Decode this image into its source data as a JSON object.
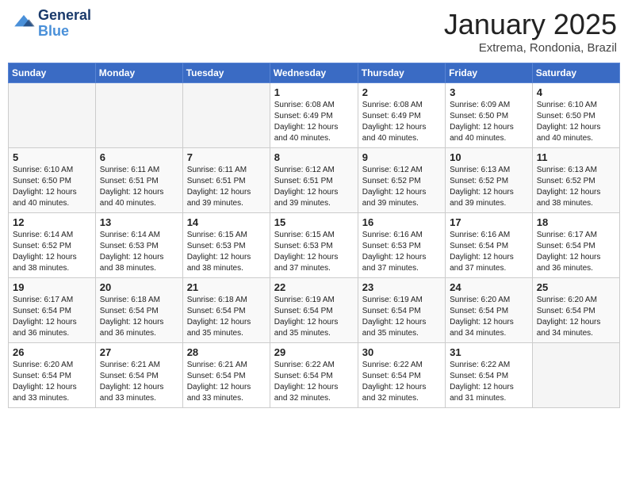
{
  "header": {
    "logo_line1": "General",
    "logo_line2": "Blue",
    "month": "January 2025",
    "location": "Extrema, Rondonia, Brazil"
  },
  "days_of_week": [
    "Sunday",
    "Monday",
    "Tuesday",
    "Wednesday",
    "Thursday",
    "Friday",
    "Saturday"
  ],
  "weeks": [
    [
      {
        "day": "",
        "info": ""
      },
      {
        "day": "",
        "info": ""
      },
      {
        "day": "",
        "info": ""
      },
      {
        "day": "1",
        "info": "Sunrise: 6:08 AM\nSunset: 6:49 PM\nDaylight: 12 hours\nand 40 minutes."
      },
      {
        "day": "2",
        "info": "Sunrise: 6:08 AM\nSunset: 6:49 PM\nDaylight: 12 hours\nand 40 minutes."
      },
      {
        "day": "3",
        "info": "Sunrise: 6:09 AM\nSunset: 6:50 PM\nDaylight: 12 hours\nand 40 minutes."
      },
      {
        "day": "4",
        "info": "Sunrise: 6:10 AM\nSunset: 6:50 PM\nDaylight: 12 hours\nand 40 minutes."
      }
    ],
    [
      {
        "day": "5",
        "info": "Sunrise: 6:10 AM\nSunset: 6:50 PM\nDaylight: 12 hours\nand 40 minutes."
      },
      {
        "day": "6",
        "info": "Sunrise: 6:11 AM\nSunset: 6:51 PM\nDaylight: 12 hours\nand 40 minutes."
      },
      {
        "day": "7",
        "info": "Sunrise: 6:11 AM\nSunset: 6:51 PM\nDaylight: 12 hours\nand 39 minutes."
      },
      {
        "day": "8",
        "info": "Sunrise: 6:12 AM\nSunset: 6:51 PM\nDaylight: 12 hours\nand 39 minutes."
      },
      {
        "day": "9",
        "info": "Sunrise: 6:12 AM\nSunset: 6:52 PM\nDaylight: 12 hours\nand 39 minutes."
      },
      {
        "day": "10",
        "info": "Sunrise: 6:13 AM\nSunset: 6:52 PM\nDaylight: 12 hours\nand 39 minutes."
      },
      {
        "day": "11",
        "info": "Sunrise: 6:13 AM\nSunset: 6:52 PM\nDaylight: 12 hours\nand 38 minutes."
      }
    ],
    [
      {
        "day": "12",
        "info": "Sunrise: 6:14 AM\nSunset: 6:52 PM\nDaylight: 12 hours\nand 38 minutes."
      },
      {
        "day": "13",
        "info": "Sunrise: 6:14 AM\nSunset: 6:53 PM\nDaylight: 12 hours\nand 38 minutes."
      },
      {
        "day": "14",
        "info": "Sunrise: 6:15 AM\nSunset: 6:53 PM\nDaylight: 12 hours\nand 38 minutes."
      },
      {
        "day": "15",
        "info": "Sunrise: 6:15 AM\nSunset: 6:53 PM\nDaylight: 12 hours\nand 37 minutes."
      },
      {
        "day": "16",
        "info": "Sunrise: 6:16 AM\nSunset: 6:53 PM\nDaylight: 12 hours\nand 37 minutes."
      },
      {
        "day": "17",
        "info": "Sunrise: 6:16 AM\nSunset: 6:54 PM\nDaylight: 12 hours\nand 37 minutes."
      },
      {
        "day": "18",
        "info": "Sunrise: 6:17 AM\nSunset: 6:54 PM\nDaylight: 12 hours\nand 36 minutes."
      }
    ],
    [
      {
        "day": "19",
        "info": "Sunrise: 6:17 AM\nSunset: 6:54 PM\nDaylight: 12 hours\nand 36 minutes."
      },
      {
        "day": "20",
        "info": "Sunrise: 6:18 AM\nSunset: 6:54 PM\nDaylight: 12 hours\nand 36 minutes."
      },
      {
        "day": "21",
        "info": "Sunrise: 6:18 AM\nSunset: 6:54 PM\nDaylight: 12 hours\nand 35 minutes."
      },
      {
        "day": "22",
        "info": "Sunrise: 6:19 AM\nSunset: 6:54 PM\nDaylight: 12 hours\nand 35 minutes."
      },
      {
        "day": "23",
        "info": "Sunrise: 6:19 AM\nSunset: 6:54 PM\nDaylight: 12 hours\nand 35 minutes."
      },
      {
        "day": "24",
        "info": "Sunrise: 6:20 AM\nSunset: 6:54 PM\nDaylight: 12 hours\nand 34 minutes."
      },
      {
        "day": "25",
        "info": "Sunrise: 6:20 AM\nSunset: 6:54 PM\nDaylight: 12 hours\nand 34 minutes."
      }
    ],
    [
      {
        "day": "26",
        "info": "Sunrise: 6:20 AM\nSunset: 6:54 PM\nDaylight: 12 hours\nand 33 minutes."
      },
      {
        "day": "27",
        "info": "Sunrise: 6:21 AM\nSunset: 6:54 PM\nDaylight: 12 hours\nand 33 minutes."
      },
      {
        "day": "28",
        "info": "Sunrise: 6:21 AM\nSunset: 6:54 PM\nDaylight: 12 hours\nand 33 minutes."
      },
      {
        "day": "29",
        "info": "Sunrise: 6:22 AM\nSunset: 6:54 PM\nDaylight: 12 hours\nand 32 minutes."
      },
      {
        "day": "30",
        "info": "Sunrise: 6:22 AM\nSunset: 6:54 PM\nDaylight: 12 hours\nand 32 minutes."
      },
      {
        "day": "31",
        "info": "Sunrise: 6:22 AM\nSunset: 6:54 PM\nDaylight: 12 hours\nand 31 minutes."
      },
      {
        "day": "",
        "info": ""
      }
    ]
  ]
}
